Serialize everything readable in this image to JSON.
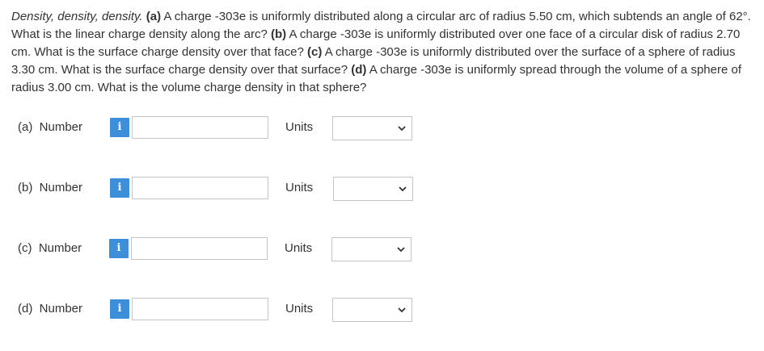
{
  "question": {
    "title": "Density, density, density.",
    "segments": [
      {
        "label": "(a)",
        "text": " A charge -303e is uniformly distributed along a circular arc of radius 5.50 cm, which subtends an angle of 62°. What is the linear charge density along the arc? "
      },
      {
        "label": "(b)",
        "text": " A charge -303e is uniformly distributed over one face of a circular disk of radius 2.70 cm. What is the surface charge density over that face? "
      },
      {
        "label": "(c)",
        "text": " A charge -303e is uniformly distributed over the surface of a sphere of radius 3.30 cm. What is the surface charge density over that surface? "
      },
      {
        "label": "(d)",
        "text": " A charge -303e is uniformly spread through the volume of a sphere of radius 3.00 cm. What is the volume charge density in that sphere?"
      }
    ]
  },
  "parts": [
    {
      "label": "(a)  Number",
      "info_icon": "i",
      "input_value": "",
      "units_label": "Units",
      "units_value": ""
    },
    {
      "label": "(b)  Number",
      "info_icon": "i",
      "input_value": "",
      "units_label": "Units",
      "units_value": ""
    },
    {
      "label": "(c)  Number",
      "info_icon": "i",
      "input_value": "",
      "units_label": "Units",
      "units_value": ""
    },
    {
      "label": "(d)  Number",
      "info_icon": "i",
      "input_value": "",
      "units_label": "Units",
      "units_value": ""
    }
  ],
  "colors": {
    "info_button": "#3d8fd9",
    "input_border": "#c4c4c4",
    "text": "#333333"
  }
}
